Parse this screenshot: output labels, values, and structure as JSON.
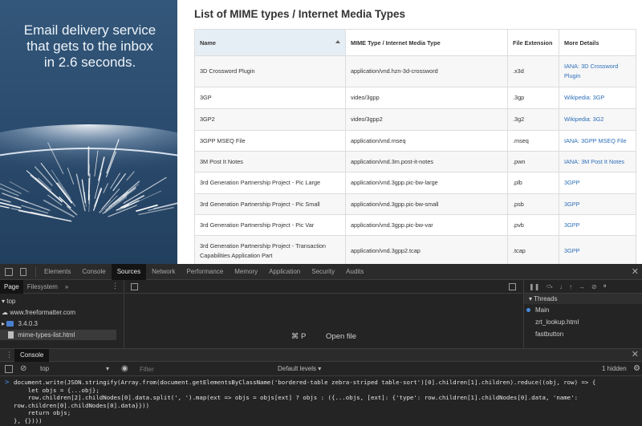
{
  "ad": {
    "lines": [
      "Email delivery service",
      "that gets to the inbox",
      "in 2.6 seconds."
    ]
  },
  "page": {
    "title": "List of MIME types / Internet Media Types"
  },
  "table": {
    "headers": [
      "Name",
      "MIME Type / Internet Media Type",
      "File Extension",
      "More Details"
    ],
    "rows": [
      {
        "name": "3D Crossword Plugin",
        "type": "application/vnd.hzn-3d-crossword",
        "ext": ".x3d",
        "details": "IANA: 3D Crossword Plugin"
      },
      {
        "name": "3GP",
        "type": "video/3gpp",
        "ext": ".3gp",
        "details": "Wikipedia: 3GP"
      },
      {
        "name": "3GP2",
        "type": "video/3gpp2",
        "ext": ".3g2",
        "details": "Wikipedia: 3G2"
      },
      {
        "name": "3GPP MSEQ File",
        "type": "application/vnd.mseq",
        "ext": ".mseq",
        "details": "IANA: 3GPP MSEQ File"
      },
      {
        "name": "3M Post It Notes",
        "type": "application/vnd.3m.post-it-notes",
        "ext": ".pwn",
        "details": "IANA: 3M Post It Notes"
      },
      {
        "name": "3rd Generation Partnership Project - Pic Large",
        "type": "application/vnd.3gpp.pic-bw-large",
        "ext": ".plb",
        "details": "3GPP"
      },
      {
        "name": "3rd Generation Partnership Project - Pic Small",
        "type": "application/vnd.3gpp.pic-bw-small",
        "ext": ".psb",
        "details": "3GPP"
      },
      {
        "name": "3rd Generation Partnership Project - Pic Var",
        "type": "application/vnd.3gpp.pic-bw-var",
        "ext": ".pvb",
        "details": "3GPP"
      },
      {
        "name": "3rd Generation Partnership Project - Transaction Capabilities Application Part",
        "type": "application/vnd.3gpp2.tcap",
        "ext": ".tcap",
        "details": "3GPP"
      }
    ]
  },
  "devtools": {
    "tabs": [
      "Elements",
      "Console",
      "Sources",
      "Network",
      "Performance",
      "Memory",
      "Application",
      "Security",
      "Audits"
    ],
    "active_tab": "Sources",
    "navigator": {
      "tabs": [
        "Page",
        "Filesystem"
      ],
      "more": "»",
      "tree": {
        "top": "top",
        "domain": "www.freeformatter.com",
        "folder": "3.4.0.3",
        "file": "mime-types-list.html"
      }
    },
    "editor": {
      "shortcut": "⌘ P",
      "hint": "Open file"
    },
    "debugger": {
      "threads_label": "Threads",
      "threads": [
        "Main",
        "zrt_lookup.html",
        "fastbutton"
      ]
    },
    "drawer": {
      "tab": "Console"
    },
    "console": {
      "context": "top",
      "filter_placeholder": "Filter",
      "levels": "Default levels",
      "hidden": "1 hidden",
      "prompt": ">",
      "code": "document.write(JSON.stringify(Array.from(document.getElementsByClassName('bordered-table zebra-striped table-sort')[0].children[1].children).reduce((obj, row) => {\n    let objs = {...obj};\n    row.children[2].childNodes[0].data.split(', ').map(ext => objs = objs[ext] ? objs : ({...objs, [ext]: {'type': row.children[1].childNodes[0].data, 'name':\nrow.children[0].childNodes[0].data}}))\n    return objs;\n}, {})))"
    }
  },
  "colors": {
    "link": "#2d6fb8",
    "ad_background": "#2a4a6c",
    "devtools_background": "#242424"
  }
}
